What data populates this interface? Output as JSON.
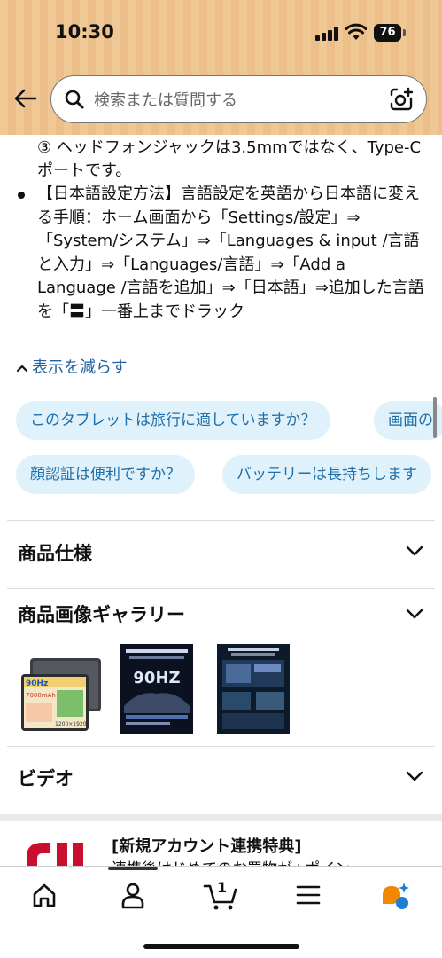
{
  "status_bar": {
    "time": "10:30",
    "battery": "76"
  },
  "search": {
    "placeholder": "検索または質問する"
  },
  "description": {
    "continuation": "③ ヘッドフォンジャックは3.5mmではなく、Type-Cポートです。",
    "bullet": "【日本語設定方法】言語設定を英語から日本語に変える手順：ホーム画面から「Settings/設定」⇒「System/システム」⇒「Languages & input /言語と入力」⇒「Languages/言語」⇒「Add a Language /言語を追加」⇒「日本語」⇒追加した言語を「〓」一番上までドラック",
    "show_less": "表示を減らす"
  },
  "question_chips": [
    "このタブレットは旅行に適していますか？",
    "画面の",
    "顔認証は便利ですか？",
    "バッテリーは長持ちします"
  ],
  "sections": {
    "specs": "商品仕様",
    "gallery": "商品画像ギャラリー",
    "video": "ビデオ"
  },
  "gallery_thumbs": {
    "thumb1": {
      "hz": "90Hz",
      "battery": "7000mAh",
      "res": "1200×1920"
    },
    "thumb2": {
      "hz": "90HZ"
    }
  },
  "promo": {
    "title": "[新規アカウント連携特典]",
    "subtitle": "連携後はじめてのお買物が+ポイン"
  },
  "nav": {
    "cart_count": "1"
  },
  "colors": {
    "header_bg": "#f0c896",
    "chip_bg": "#dff1fb",
    "link": "#2162a1",
    "promo_red": "#c8102e"
  }
}
